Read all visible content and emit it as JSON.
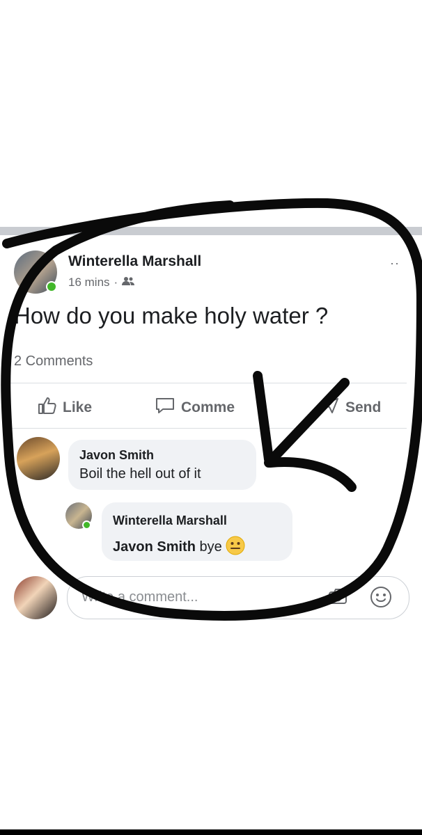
{
  "post": {
    "author": "Winterella Marshall",
    "time": "16 mins",
    "separator": "·",
    "text": "How do you make holy water ?",
    "comments_count": "2 Comments",
    "more": "··"
  },
  "actions": {
    "like": "Like",
    "comment": "Comme",
    "send": "Send"
  },
  "comments": [
    {
      "name": "Javon Smith",
      "text": "Boil the hell out of it"
    },
    {
      "name": "Winterella Marshall",
      "mention": "Javon Smith",
      "text": "bye"
    }
  ],
  "write_comment": {
    "placeholder": "Write a comment..."
  },
  "icons": [
    "friends-icon",
    "like-icon",
    "comment-icon",
    "send-icon",
    "smiley-emoji-icon",
    "camera-icon",
    "emoji-icon"
  ],
  "colors": {
    "online": "#42b72a",
    "marker": "#0a0a0a",
    "muted": "#65676b"
  }
}
